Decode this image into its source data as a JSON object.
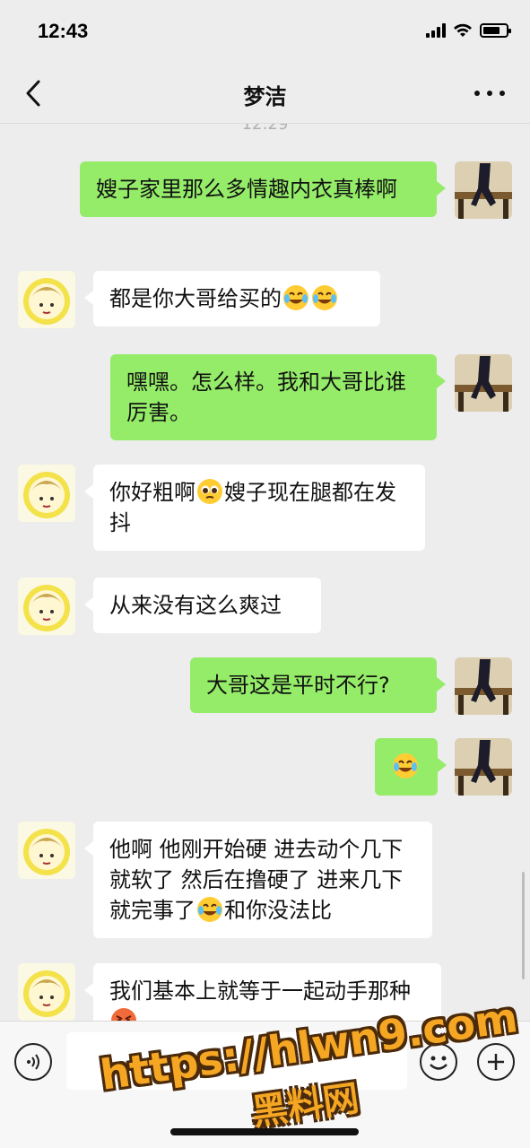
{
  "status_bar": {
    "time": "12:43"
  },
  "nav": {
    "title": "梦洁"
  },
  "chat": {
    "timestamp": "12:29",
    "messages": [
      {
        "side": "right",
        "text": "嫂子家里那么多情趣内衣真棒啊"
      },
      {
        "side": "left",
        "text": "都是你大哥给买的",
        "emojis": [
          "face-with-tears-of-joy",
          "face-with-tears-of-joy"
        ]
      },
      {
        "side": "right",
        "text": "嘿嘿。怎么样。我和大哥比谁厉害。"
      },
      {
        "side": "left",
        "text_before": "你好粗啊",
        "emoji": "pleading-face",
        "text_after": "嫂子现在腿都在发抖"
      },
      {
        "side": "left",
        "text": "从来没有这么爽过"
      },
      {
        "side": "right",
        "text": "大哥这是平时不行?"
      },
      {
        "side": "right",
        "emoji": "face-with-tears-of-joy"
      },
      {
        "side": "left",
        "text_before": "他啊 他刚开始硬 进去动个几下就软了 然后在撸硬了 进来几下就完事了",
        "emoji": "face-with-tears-of-joy",
        "text_after": "和你没法比"
      },
      {
        "side": "left",
        "text": "我们基本上就等于一起动手那种",
        "emoji": "angry-face"
      }
    ]
  },
  "watermark": {
    "url": "https://hlwn9.com",
    "name": "黑料网"
  },
  "colors": {
    "sent_bubble": "#95ec69",
    "received_bubble": "#ffffff",
    "background": "#ededed",
    "watermark": "#f5a623"
  }
}
